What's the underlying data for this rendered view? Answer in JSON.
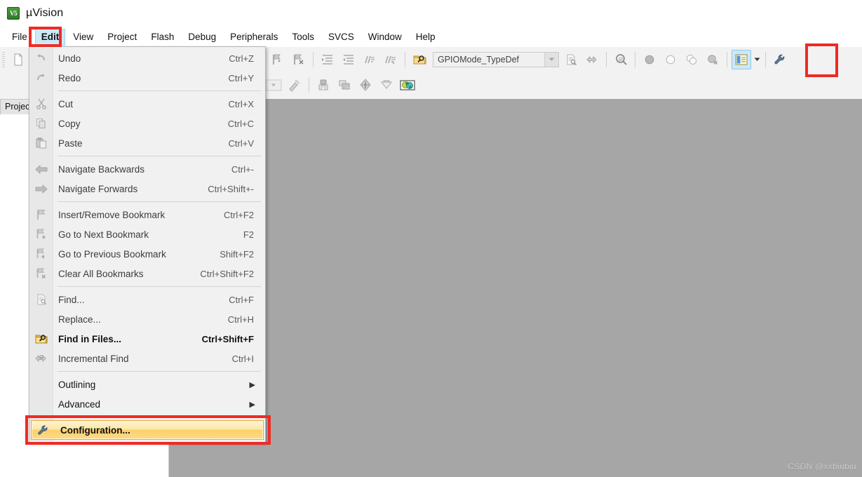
{
  "window": {
    "title": "µVision",
    "icon": "uvision-v5-icon",
    "icon_text": "V5"
  },
  "menubar": {
    "items": [
      {
        "label": "File",
        "open": false
      },
      {
        "label": "Edit",
        "open": true
      },
      {
        "label": "View",
        "open": false
      },
      {
        "label": "Project",
        "open": false
      },
      {
        "label": "Flash",
        "open": false
      },
      {
        "label": "Debug",
        "open": false
      },
      {
        "label": "Peripherals",
        "open": false
      },
      {
        "label": "Tools",
        "open": false
      },
      {
        "label": "SVCS",
        "open": false
      },
      {
        "label": "Window",
        "open": false
      },
      {
        "label": "Help",
        "open": false
      }
    ]
  },
  "toolbar": {
    "symbol_combo_value": "GPIOMode_TypeDef",
    "symbol_combo_placeholder": "GPIOMode_TypeDef",
    "row1_icons": [
      "new-file-icon",
      "insert-bookmark-icon",
      "previous-bookmark-icon",
      "next-bookmark-icon",
      "clear-bookmarks-icon",
      "indent-icon",
      "outdent-icon",
      "comment-icon",
      "uncomment-icon",
      "find-in-files-icon",
      "go-to-definition-icon",
      "incremental-find-icon",
      "magnifier-icon",
      "breakpoint-icon",
      "disable-breakpoint-icon",
      "kill-breakpoints-icon",
      "disable-all-breakpoints-icon",
      "project-window-icon",
      "configuration-wrench-icon"
    ],
    "row2_icons": [
      "target-options-icon",
      "build-icon",
      "rebuild-icon",
      "batch-build-icon",
      "download-icon",
      "debug-session-icon"
    ]
  },
  "left_panel": {
    "tab_label": "Project"
  },
  "edit_menu": {
    "groups": [
      {
        "items": [
          {
            "label": "Undo",
            "accel": "Ctrl+Z",
            "icon": "undo-icon",
            "enabled": false,
            "submenu": false
          },
          {
            "label": "Redo",
            "accel": "Ctrl+Y",
            "icon": "redo-icon",
            "enabled": false,
            "submenu": false
          }
        ]
      },
      {
        "items": [
          {
            "label": "Cut",
            "accel": "Ctrl+X",
            "icon": "cut-icon",
            "enabled": false,
            "submenu": false
          },
          {
            "label": "Copy",
            "accel": "Ctrl+C",
            "icon": "copy-icon",
            "enabled": false,
            "submenu": false
          },
          {
            "label": "Paste",
            "accel": "Ctrl+V",
            "icon": "paste-icon",
            "enabled": false,
            "submenu": false
          }
        ]
      },
      {
        "items": [
          {
            "label": "Navigate Backwards",
            "accel": "Ctrl+-",
            "icon": "arrow-left-icon",
            "enabled": false,
            "submenu": false
          },
          {
            "label": "Navigate Forwards",
            "accel": "Ctrl+Shift+-",
            "icon": "arrow-right-icon",
            "enabled": false,
            "submenu": false
          }
        ]
      },
      {
        "items": [
          {
            "label": "Insert/Remove Bookmark",
            "accel": "Ctrl+F2",
            "icon": "bookmark-toggle-icon",
            "enabled": false,
            "submenu": false
          },
          {
            "label": "Go to Next Bookmark",
            "accel": "F2",
            "icon": "bookmark-next-icon",
            "enabled": false,
            "submenu": false
          },
          {
            "label": "Go to Previous Bookmark",
            "accel": "Shift+F2",
            "icon": "bookmark-previous-icon",
            "enabled": false,
            "submenu": false
          },
          {
            "label": "Clear All Bookmarks",
            "accel": "Ctrl+Shift+F2",
            "icon": "bookmark-clear-icon",
            "enabled": false,
            "submenu": false
          }
        ]
      },
      {
        "items": [
          {
            "label": "Find...",
            "accel": "Ctrl+F",
            "icon": "find-icon",
            "enabled": false,
            "submenu": false
          },
          {
            "label": "Replace...",
            "accel": "Ctrl+H",
            "icon": "none",
            "enabled": false,
            "submenu": false
          },
          {
            "label": "Find in Files...",
            "accel": "Ctrl+Shift+F",
            "icon": "find-in-files-icon",
            "enabled": true,
            "submenu": false
          },
          {
            "label": "Incremental Find",
            "accel": "Ctrl+I",
            "icon": "incremental-find-icon",
            "enabled": false,
            "submenu": false
          }
        ]
      },
      {
        "items": [
          {
            "label": "Outlining",
            "accel": "",
            "icon": "none",
            "enabled": true,
            "submenu": true
          },
          {
            "label": "Advanced",
            "accel": "",
            "icon": "none",
            "enabled": true,
            "submenu": true
          }
        ]
      },
      {
        "items": [
          {
            "label": "Configuration...",
            "accel": "",
            "icon": "configuration-wrench-icon",
            "enabled": true,
            "submenu": false,
            "highlighted": true
          }
        ]
      }
    ],
    "submenu_arrow": "▶"
  },
  "annotations": {
    "boxes": [
      {
        "name": "edit-menu-highlight-box",
        "color": "#ee2b24"
      },
      {
        "name": "wrench-toolbar-highlight-box",
        "color": "#ee2b24"
      },
      {
        "name": "configuration-highlight-box",
        "color": "#ee2b24"
      }
    ]
  },
  "watermark": {
    "text": "CSDN @xxbiubiu"
  },
  "colors": {
    "menu_background": "#f1f1f1",
    "menu_gutter": "#e8e8e8",
    "mdi_background": "#a6a6a6",
    "toolbar_background": "#f2f2f2",
    "highlight_orange": "#fcd06a",
    "annotation_red": "#ee2b24",
    "menu_open_blue": "#cde8f7"
  }
}
